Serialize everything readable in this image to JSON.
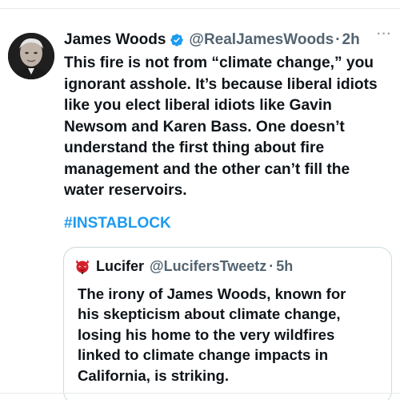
{
  "tweet": {
    "author": {
      "display_name": "James Woods",
      "handle": "@RealJamesWoods",
      "verified": true,
      "avatar_icon": "user-avatar-photo"
    },
    "separator": "·",
    "time": "2h",
    "more_label": "···",
    "text": "This fire is not from “climate change,” you\nignorant asshole. It’s because liberal idiots\nlike you elect liberal idiots like Gavin\nNewsom and Karen Bass. One doesn’t\nunderstand the first thing about fire\nmanagement and the other can’t fill the\nwater reservoirs.",
    "hashtag": "#INSTABLOCK",
    "colors": {
      "link": "#1d9bf0",
      "verified_badge": "#1d9bf0",
      "secondary_text": "#536471"
    }
  },
  "quoted_tweet": {
    "author": {
      "display_name": "Lucifer",
      "handle": "@LucifersTweetz",
      "avatar_icon": "red-devil-icon"
    },
    "separator": "·",
    "time": "5h",
    "text": "The irony of James Woods, known for\nhis skepticism about climate change,\nlosing his home to the very wildfires\nlinked to climate change impacts in\nCalifornia, is striking."
  }
}
